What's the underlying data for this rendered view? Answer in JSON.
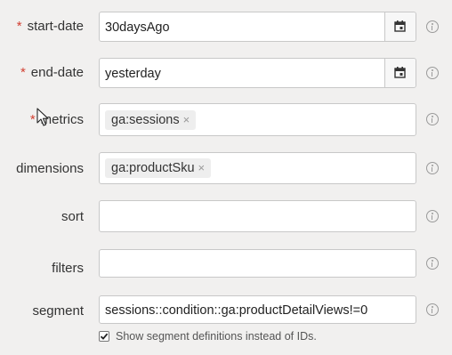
{
  "form": {
    "start_date": {
      "label": "start-date",
      "required_marker": "*",
      "value": "30daysAgo"
    },
    "end_date": {
      "label": "end-date",
      "required_marker": "*",
      "value": "yesterday"
    },
    "metrics": {
      "label": "metrics",
      "required_marker": "*",
      "chips": [
        "ga:sessions"
      ]
    },
    "dimensions": {
      "label": "dimensions",
      "chips": [
        "ga:productSku"
      ]
    },
    "sort": {
      "label": "sort",
      "value": ""
    },
    "filters": {
      "label": "filters",
      "value": ""
    },
    "segment": {
      "label": "segment",
      "value": "sessions::condition::ga:productDetailViews!=0"
    },
    "show_segment_definitions": {
      "label": "Show segment definitions instead of IDs.",
      "checked": true
    }
  },
  "icons": {
    "calendar": "calendar-icon",
    "info": "info-icon",
    "remove_chip": "×",
    "cursor": "mouse-pointer-icon"
  },
  "colors": {
    "required": "#d23f31",
    "background": "#f1f0ef",
    "field_border": "#c8c8c8",
    "chip_bg": "#eeeeee"
  }
}
